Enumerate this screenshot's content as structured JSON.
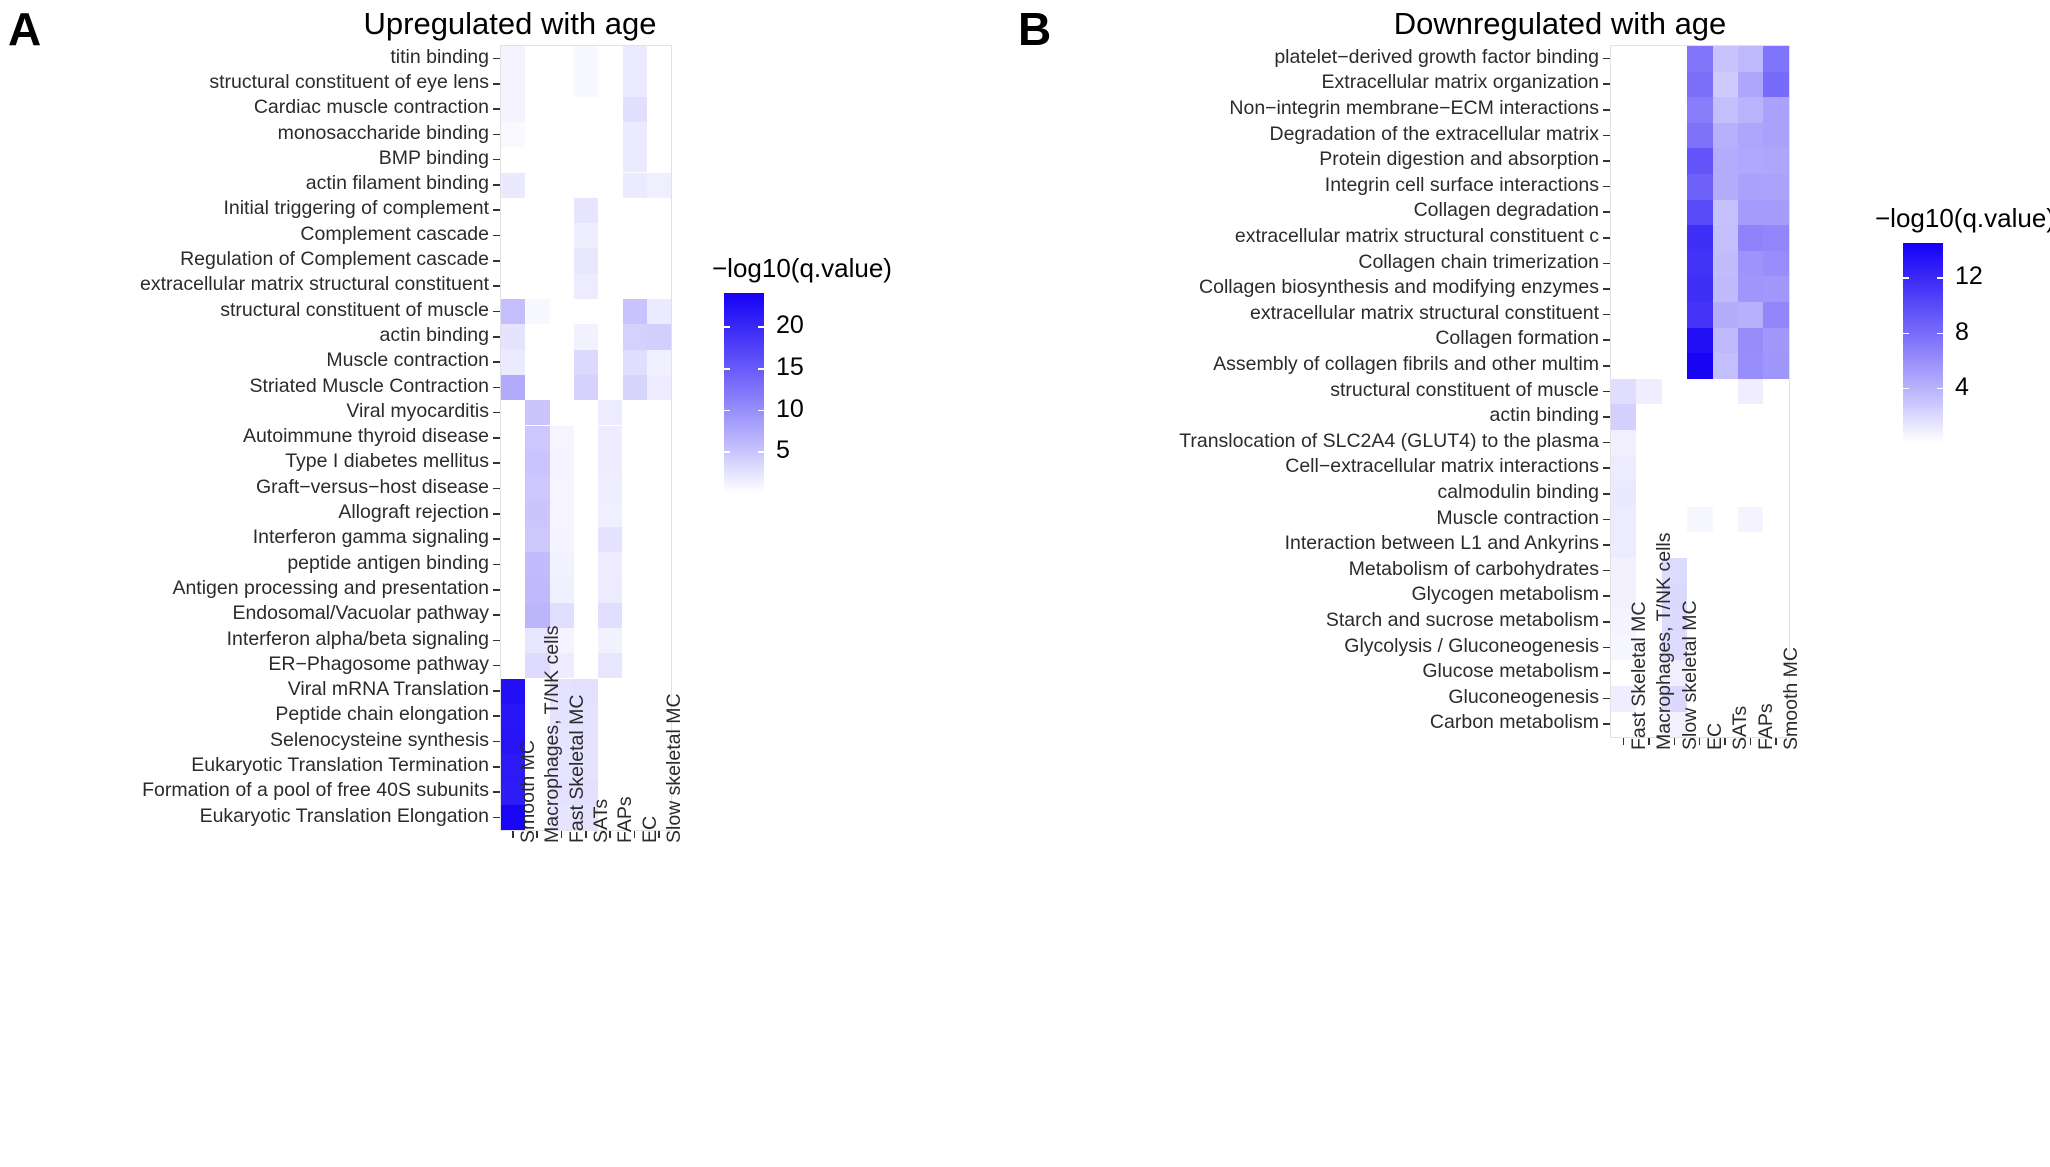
{
  "figure": {
    "colorbar_low": "#ffffff",
    "colorbar_high": "#1500f5",
    "panel_bg": "#ffffff"
  },
  "panel_a": {
    "letter": "A",
    "title": "Upregulated with age",
    "legend": {
      "title": "−log10(q.value)",
      "ticks": [
        20,
        15,
        10,
        5
      ],
      "tick_labels": [
        "20",
        "15",
        "10",
        "5"
      ],
      "vmin": 0,
      "vmax": 24
    },
    "columns": [
      "Smooth MC",
      "Macrophages, T/NK cells",
      "Fast Skeletal MC",
      "SATs",
      "FAPs",
      "EC",
      "Slow skeletal MC"
    ],
    "rows": [
      "titin binding",
      "structural constituent of eye lens",
      "Cardiac muscle contraction",
      "monosaccharide binding",
      "BMP binding",
      "actin filament binding",
      "Initial triggering of complement",
      "Complement cascade",
      "Regulation of Complement cascade",
      "extracellular matrix structural constituent",
      "structural constituent of muscle",
      "actin binding",
      "Muscle contraction",
      "Striated Muscle Contraction",
      "Viral myocarditis",
      "Autoimmune thyroid disease",
      "Type I diabetes mellitus",
      "Graft−versus−host disease",
      "Allograft rejection",
      "Interferon gamma signaling",
      "peptide antigen binding",
      "Antigen processing and presentation",
      "Endosomal/Vacuolar pathway",
      "Interferon alpha/beta signaling",
      "ER−Phagosome pathway",
      "Viral mRNA Translation",
      "Peptide chain elongation",
      "Selenocysteine synthesis",
      "Eukaryotic Translation Termination",
      "Formation of a pool of free 40S subunits",
      "Eukaryotic Translation Elongation"
    ]
  },
  "panel_b": {
    "letter": "B",
    "title": "Downregulated with age",
    "legend": {
      "title": "−log10(q.value)",
      "ticks": [
        12,
        8,
        4
      ],
      "tick_labels": [
        "12",
        "8",
        "4"
      ],
      "vmin": 0,
      "vmax": 14.5
    },
    "columns": [
      "Fast Skeletal MC",
      "Macrophages, T/NK cells",
      "Slow skeletal MC",
      "EC",
      "SATs",
      "FAPs",
      "Smooth MC"
    ],
    "rows": [
      "platelet−derived growth factor binding",
      "Extracellular matrix organization",
      "Non−integrin membrane−ECM interactions",
      "Degradation of the extracellular matrix",
      "Protein digestion and absorption",
      "Integrin cell surface interactions",
      "Collagen degradation",
      "extracellular matrix structural constituent c",
      "Collagen chain trimerization",
      "Collagen biosynthesis and modifying enzymes",
      "extracellular matrix structural constituent",
      "Collagen formation",
      "Assembly of collagen fibrils and other multim",
      "structural constituent of muscle",
      "actin binding",
      "Translocation of SLC2A4 (GLUT4) to the plasma",
      "Cell−extracellular matrix interactions",
      "calmodulin binding",
      "Muscle contraction",
      "Interaction between L1 and Ankyrins",
      "Metabolism of carbohydrates",
      "Glycogen metabolism",
      "Starch and sucrose metabolism",
      "Glycolysis / Gluconeogenesis",
      "Glucose metabolism",
      "Gluconeogenesis",
      "Carbon metabolism"
    ]
  },
  "chart_data": [
    {
      "type": "heatmap",
      "panel": "A",
      "title": "Upregulated with age",
      "xlabel": "",
      "ylabel": "",
      "colorbar_label": "−log10(q.value)",
      "zlim": [
        0,
        24
      ],
      "colorscale": [
        "#ffffff",
        "#1500f5"
      ],
      "x": [
        "Smooth MC",
        "Macrophages, T/NK cells",
        "Fast Skeletal MC",
        "SATs",
        "FAPs",
        "EC",
        "Slow skeletal MC"
      ],
      "y": [
        "titin binding",
        "structural constituent of eye lens",
        "Cardiac muscle contraction",
        "monosaccharide binding",
        "BMP binding",
        "actin filament binding",
        "Initial triggering of complement",
        "Complement cascade",
        "Regulation of Complement cascade",
        "extracellular matrix structural constituent",
        "structural constituent of muscle",
        "actin binding",
        "Muscle contraction",
        "Striated Muscle Contraction",
        "Viral myocarditis",
        "Autoimmune thyroid disease",
        "Type I diabetes mellitus",
        "Graft−versus−host disease",
        "Allograft rejection",
        "Interferon gamma signaling",
        "peptide antigen binding",
        "Antigen processing and presentation",
        "Endosomal/Vacuolar pathway",
        "Interferon alpha/beta signaling",
        "ER−Phagosome pathway",
        "Viral mRNA Translation",
        "Peptide chain elongation",
        "Selenocysteine synthesis",
        "Eukaryotic Translation Termination",
        "Formation of a pool of free 40S subunits",
        "Eukaryotic Translation Elongation"
      ],
      "z": [
        [
          0.9,
          0,
          0,
          0.5,
          0,
          1.6,
          0
        ],
        [
          0.9,
          0,
          0,
          0.5,
          0,
          1.6,
          0
        ],
        [
          0.9,
          0,
          0,
          0,
          0,
          2.6,
          0
        ],
        [
          0.4,
          0,
          0,
          0,
          0,
          1.6,
          0
        ],
        [
          0,
          0,
          0,
          0,
          0,
          1.6,
          0
        ],
        [
          1.7,
          0,
          0,
          0,
          0,
          1.6,
          1.2
        ],
        [
          0,
          0,
          0,
          2.0,
          0,
          0,
          0
        ],
        [
          0,
          0,
          0,
          1.3,
          0,
          0,
          0
        ],
        [
          0,
          0,
          0,
          1.8,
          0,
          0,
          0
        ],
        [
          0,
          0,
          0,
          1.5,
          0,
          0,
          0
        ],
        [
          5.4,
          0.5,
          0,
          0,
          0,
          5.0,
          1.6
        ],
        [
          2.2,
          0,
          0,
          1.0,
          0,
          3.7,
          3.9
        ],
        [
          1.6,
          0,
          0,
          3.0,
          0,
          2.7,
          1.1
        ],
        [
          7.2,
          0,
          0,
          3.6,
          0,
          3.4,
          1.4
        ],
        [
          0,
          4.8,
          0,
          0,
          1.5,
          0,
          0
        ],
        [
          0,
          4.6,
          0.7,
          0,
          1.4,
          0,
          0
        ],
        [
          0,
          4.9,
          0.9,
          0,
          1.4,
          0,
          0
        ],
        [
          0,
          4.6,
          0.8,
          0,
          1.3,
          0,
          0
        ],
        [
          0,
          4.8,
          0.8,
          0,
          1.2,
          0,
          0
        ],
        [
          0,
          4.4,
          0.9,
          0,
          2.2,
          0,
          0
        ],
        [
          0,
          5.6,
          1.0,
          0,
          1.4,
          0,
          0
        ],
        [
          0,
          5.8,
          1.1,
          0,
          1.5,
          0,
          0
        ],
        [
          0,
          6.3,
          2.5,
          0,
          2.6,
          0,
          0
        ],
        [
          0,
          1.9,
          0.9,
          0,
          1.0,
          0,
          0
        ],
        [
          0,
          2.9,
          1.4,
          0,
          1.9,
          0,
          0
        ],
        [
          22.5,
          0,
          2.3,
          2.4,
          0,
          0,
          0
        ],
        [
          21.8,
          0,
          2.2,
          2.3,
          0,
          0,
          0
        ],
        [
          22.0,
          0,
          2.1,
          2.2,
          0,
          0,
          0
        ],
        [
          21.5,
          0,
          2.1,
          2.2,
          0,
          0,
          0
        ],
        [
          21.2,
          0,
          2.3,
          2.4,
          0,
          0,
          0
        ],
        [
          23.5,
          0,
          2.1,
          2.2,
          0,
          0,
          0
        ]
      ]
    },
    {
      "type": "heatmap",
      "panel": "B",
      "title": "Downregulated with age",
      "xlabel": "",
      "ylabel": "",
      "colorbar_label": "−log10(q.value)",
      "zlim": [
        0,
        14.5
      ],
      "colorscale": [
        "#ffffff",
        "#1500f5"
      ],
      "x": [
        "Fast Skeletal MC",
        "Macrophages, T/NK cells",
        "Slow skeletal MC",
        "EC",
        "SATs",
        "FAPs",
        "Smooth MC"
      ],
      "y": [
        "platelet−derived growth factor binding",
        "Extracellular matrix organization",
        "Non−integrin membrane−ECM interactions",
        "Degradation of the extracellular matrix",
        "Protein digestion and absorption",
        "Integrin cell surface interactions",
        "Collagen degradation",
        "extracellular matrix structural constituent c",
        "Collagen chain trimerization",
        "Collagen biosynthesis and modifying enzymes",
        "extracellular matrix structural constituent",
        "Collagen formation",
        "Assembly of collagen fibrils and other multim",
        "structural constituent of muscle",
        "actin binding",
        "Translocation of SLC2A4 (GLUT4) to the plasma",
        "Cell−extracellular matrix interactions",
        "calmodulin binding",
        "Muscle contraction",
        "Interaction between L1 and Ankyrins",
        "Metabolism of carbohydrates",
        "Glycogen metabolism",
        "Starch and sucrose metabolism",
        "Glycolysis / Gluconeogenesis",
        "Glucose metabolism",
        "Gluconeogenesis",
        "Carbon metabolism"
      ],
      "z": [
        [
          0,
          0,
          0,
          7.4,
          3.0,
          3.6,
          7.5
        ],
        [
          0,
          0,
          0,
          7.8,
          2.6,
          4.6,
          8.0
        ],
        [
          0,
          0,
          0,
          7.0,
          3.3,
          3.9,
          4.9
        ],
        [
          0,
          0,
          0,
          7.6,
          4.1,
          4.6,
          4.9
        ],
        [
          0,
          0,
          0,
          9.4,
          4.3,
          4.5,
          4.6
        ],
        [
          0,
          0,
          0,
          8.6,
          4.2,
          4.9,
          4.8
        ],
        [
          0,
          0,
          0,
          10.0,
          3.1,
          5.2,
          5.2
        ],
        [
          0,
          0,
          0,
          11.6,
          3.3,
          6.6,
          6.4
        ],
        [
          0,
          0,
          0,
          11.4,
          3.4,
          5.7,
          6.0
        ],
        [
          0,
          0,
          0,
          11.6,
          3.5,
          5.5,
          5.4
        ],
        [
          0,
          0,
          0,
          11.3,
          4.2,
          4.0,
          6.4
        ],
        [
          0,
          0,
          0,
          13.6,
          3.6,
          6.1,
          5.4
        ],
        [
          0,
          0,
          0,
          14.3,
          3.3,
          6.0,
          5.5
        ],
        [
          1.6,
          0.8,
          0,
          0,
          0,
          0.8,
          0
        ],
        [
          2.3,
          0,
          0,
          0,
          0,
          0,
          0
        ],
        [
          0.7,
          0,
          0,
          0,
          0,
          0,
          0
        ],
        [
          0.9,
          0,
          0,
          0,
          0,
          0,
          0
        ],
        [
          1.0,
          0,
          0,
          0,
          0,
          0,
          0
        ],
        [
          0.9,
          0,
          0,
          0.4,
          0,
          0.5,
          0
        ],
        [
          0.9,
          0,
          0,
          0,
          0,
          0,
          0
        ],
        [
          0.6,
          0,
          1.7,
          0,
          0,
          0,
          0
        ],
        [
          0.6,
          0,
          1.9,
          0,
          0,
          0,
          0
        ],
        [
          0.5,
          0,
          1.8,
          0,
          0,
          0,
          0
        ],
        [
          0.4,
          0,
          1.7,
          0,
          0,
          0,
          0
        ],
        [
          0,
          0,
          0.7,
          0,
          0,
          0,
          0
        ],
        [
          0.8,
          0,
          1.9,
          0,
          0,
          0,
          0
        ],
        [
          0,
          0,
          0.6,
          0,
          0,
          0,
          0
        ]
      ]
    }
  ]
}
